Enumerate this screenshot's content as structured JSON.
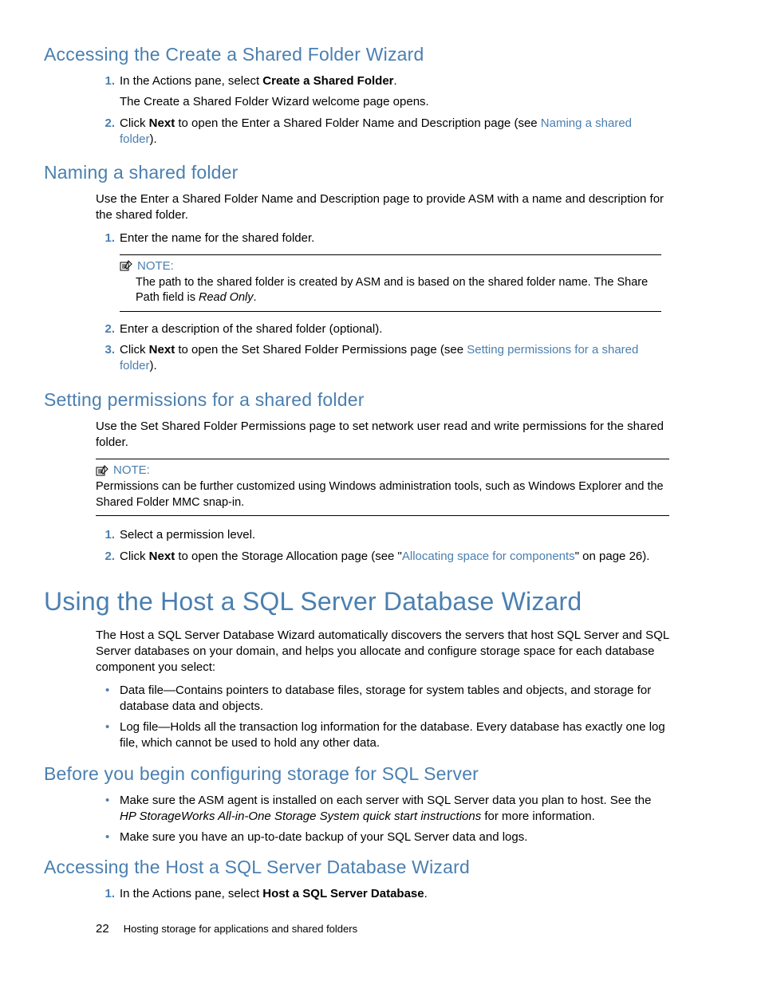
{
  "sections": {
    "s1": {
      "title": "Accessing the Create a Shared Folder Wizard",
      "step1_a": "In the Actions pane, select ",
      "step1_b": "Create a Shared Folder",
      "step1_c": ".",
      "step1_sub": "The Create a Shared Folder Wizard welcome page opens.",
      "step2_a": "Click ",
      "step2_b": "Next",
      "step2_c": " to open the Enter a Shared Folder Name and Description page (see ",
      "step2_link": "Naming a shared folder",
      "step2_d": ")."
    },
    "s2": {
      "title": "Naming a shared folder",
      "intro": "Use the Enter a Shared Folder Name and Description page to provide ASM with a name and description for the shared folder.",
      "step1": "Enter the name for the shared folder.",
      "note_label": "NOTE:",
      "note_a": "The path to the shared folder is created by ASM and is based on the shared folder name. The Share Path field is ",
      "note_b": "Read Only",
      "note_c": ".",
      "step2": "Enter a description of the shared folder (optional).",
      "step3_a": "Click ",
      "step3_b": "Next",
      "step3_c": " to open the Set Shared Folder Permissions page (see ",
      "step3_link": "Setting permissions for a shared folder",
      "step3_d": ")."
    },
    "s3": {
      "title": "Setting permissions for a shared folder",
      "intro": "Use the Set Shared Folder Permissions page to set network user read and write permissions for the shared folder.",
      "note_label": "NOTE:",
      "note_body": "Permissions can be further customized using Windows administration tools, such as Windows Explorer and the Shared Folder MMC snap-in.",
      "step1": "Select a permission level.",
      "step2_a": "Click ",
      "step2_b": "Next",
      "step2_c": " to open the Storage Allocation page (see \"",
      "step2_link": "Allocating space for components",
      "step2_d": "\" on page 26)."
    },
    "s4": {
      "title": "Using the Host a SQL Server Database Wizard",
      "intro": "The Host a SQL Server Database Wizard automatically discovers the servers that host SQL Server and SQL Server databases on your domain, and helps you allocate and configure storage space for each database component you select:",
      "b1": "Data file—Contains pointers to database files, storage for system tables and objects, and storage for database data and objects.",
      "b2": "Log file—Holds all the transaction log information for the database. Every database has exactly one log file, which cannot be used to hold any other data."
    },
    "s5": {
      "title": "Before you begin configuring storage for SQL Server",
      "b1_a": "Make sure the ASM agent is installed on each server with SQL Server data you plan to host. See the ",
      "b1_b": "HP StorageWorks All-in-One Storage System quick start instructions",
      "b1_c": " for more information.",
      "b2": "Make sure you have an up-to-date backup of your SQL Server data and logs."
    },
    "s6": {
      "title": "Accessing the Host a SQL Server Database Wizard",
      "step1_a": "In the Actions pane, select ",
      "step1_b": "Host a SQL Server Database",
      "step1_c": "."
    }
  },
  "nums": {
    "n1": "1.",
    "n2": "2.",
    "n3": "3."
  },
  "footer": {
    "page": "22",
    "chapter": "Hosting storage for applications and shared folders"
  }
}
